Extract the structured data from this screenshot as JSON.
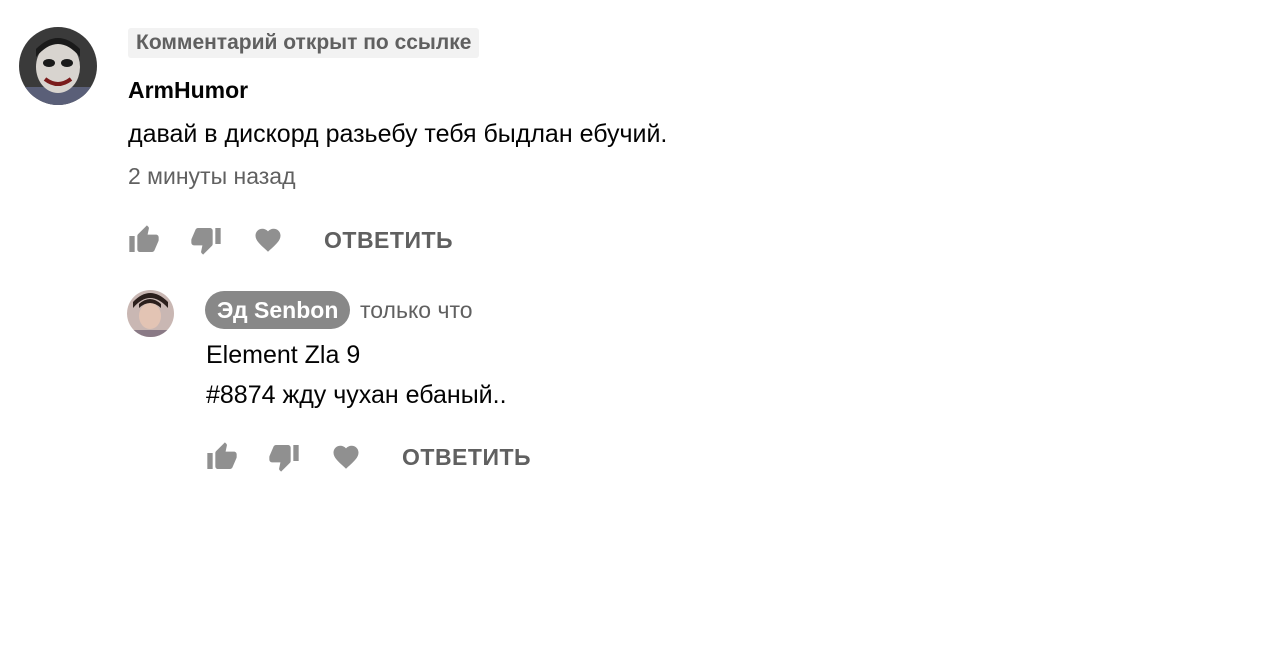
{
  "comment": {
    "link_badge": "Комментарий открыт по ссылке",
    "author": "ArmHumor",
    "text": "давай в дискорд разьебу тебя быдлан ебучий.",
    "timestamp": "2 минуты назад",
    "actions": {
      "like_icon": "thumbs-up-icon",
      "dislike_icon": "thumbs-down-icon",
      "heart_icon": "heart-icon",
      "reply_label": "ОТВЕТИТЬ"
    }
  },
  "reply": {
    "author": "Эд Senbon",
    "timestamp": "только что",
    "text_lines": [
      "Element Zla 9",
      "#8874 жду чухан ебаный.."
    ],
    "actions": {
      "like_icon": "thumbs-up-icon",
      "dislike_icon": "thumbs-down-icon",
      "heart_icon": "heart-icon",
      "reply_label": "ОТВЕТИТЬ"
    }
  },
  "colors": {
    "secondary_text": "#606060",
    "icon": "#909090",
    "chip_bg": "#888888",
    "badge_bg": "#f2f2f2"
  }
}
